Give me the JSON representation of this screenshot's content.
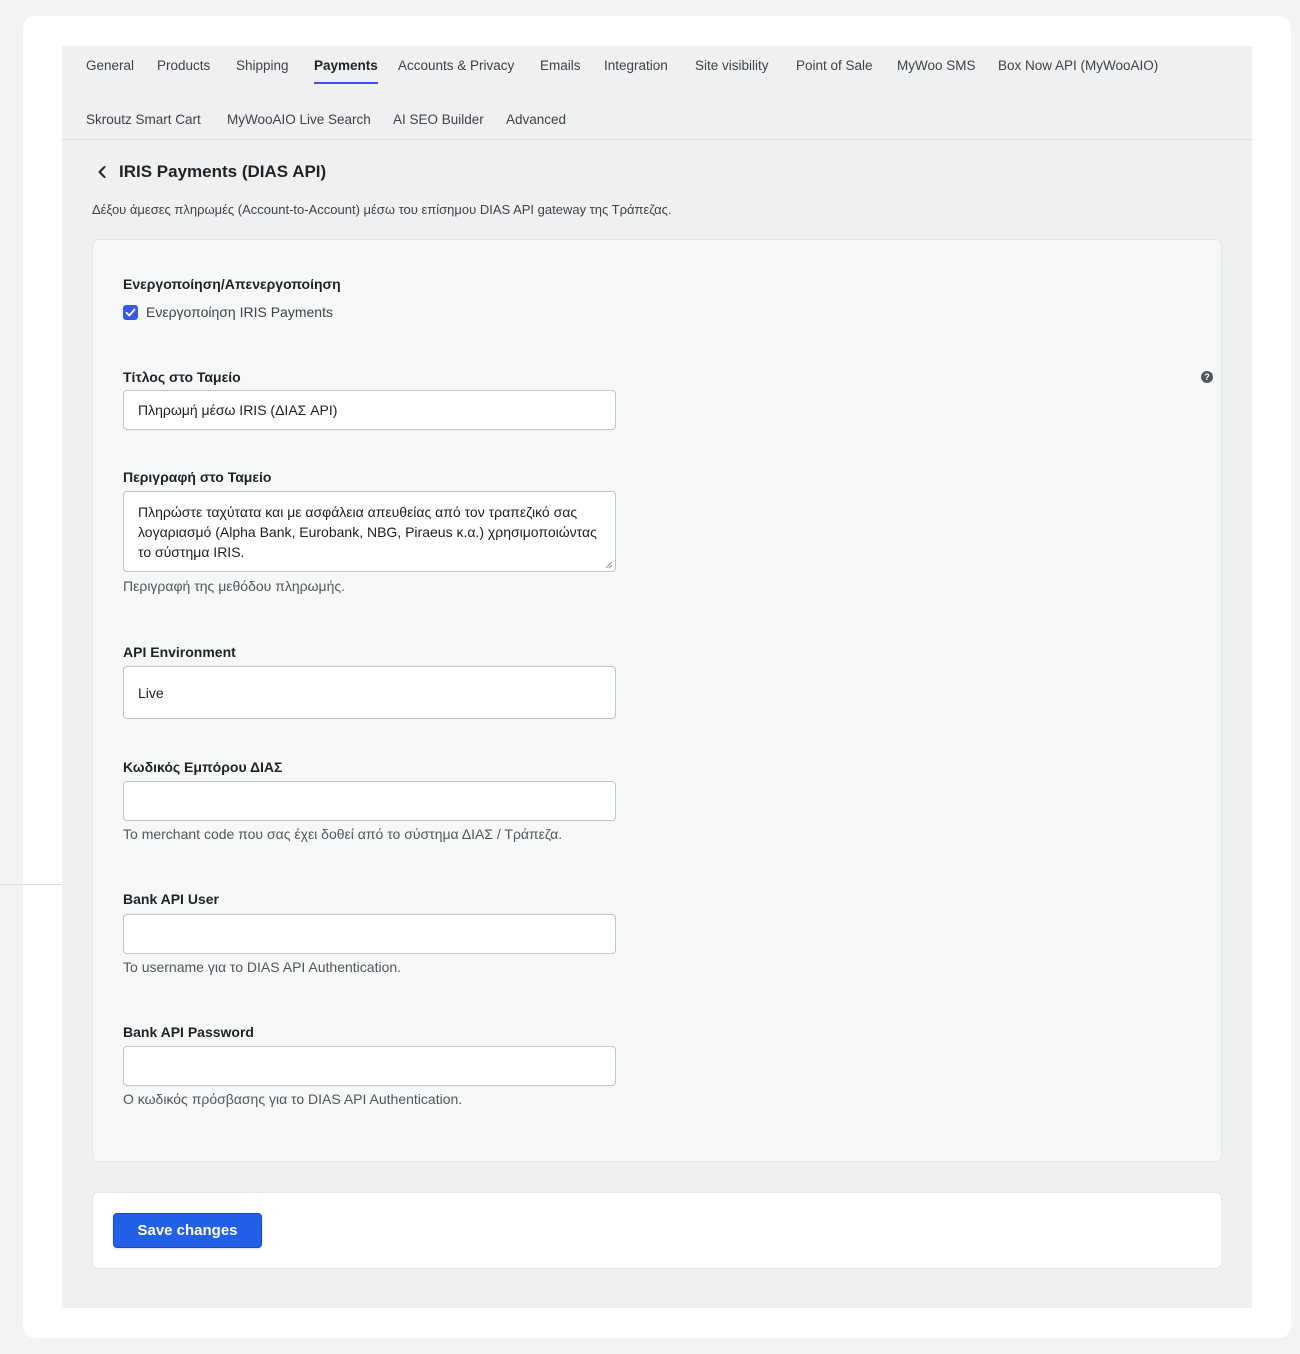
{
  "tabs": {
    "row1": [
      "General",
      "Products",
      "Shipping",
      "Payments",
      "Accounts & Privacy",
      "Emails",
      "Integration",
      "Site visibility",
      "Point of Sale",
      "MyWoo SMS",
      "Box Now API (MyWooAIO)"
    ],
    "row2": [
      "Skroutz Smart Cart",
      "MyWooAIO Live Search",
      "AI SEO Builder",
      "Advanced"
    ],
    "active": "Payments"
  },
  "page": {
    "title": "IRIS Payments (DIAS API)",
    "description": "Δέξου άμεσες πληρωμές (Account-to-Account) μέσω του επίσημου DIAS API gateway της Τράπεζας."
  },
  "form": {
    "enable": {
      "label": "Ενεργοποίηση/Απενεργοποίηση",
      "checkbox_label": "Ενεργοποίηση IRIS Payments",
      "checked": true
    },
    "title": {
      "label": "Τίτλος στο Ταμείο",
      "value": "Πληρωμή μέσω IRIS (ΔΙΑΣ API)",
      "help_icon": "question-circle-icon"
    },
    "description": {
      "label": "Περιγραφή στο Ταμείο",
      "value": "Πληρώστε ταχύτατα και με ασφάλεια απευθείας από τον τραπεζικό σας λογαριασμό (Alpha Bank, Eurobank, NBG, Piraeus κ.α.) χρησιμοποιώντας το σύστημα IRIS.",
      "help": "Περιγραφή της μεθόδου πληρωμής."
    },
    "api_environment": {
      "label": "API Environment",
      "value": "Live"
    },
    "merchant_code": {
      "label": "Κωδικός Εμπόρου ΔΙΑΣ",
      "value": "",
      "help": "Το merchant code που σας έχει δοθεί από το σύστημα ΔΙΑΣ / Τράπεζα."
    },
    "api_user": {
      "label": "Bank API User",
      "value": "",
      "help": "Το username για το DIAS API Authentication."
    },
    "api_password": {
      "label": "Bank API Password",
      "value": "",
      "help": "Ο κωδικός πρόσβασης για το DIAS API Authentication."
    }
  },
  "actions": {
    "save_label": "Save changes"
  },
  "colors": {
    "accent": "#3858e9",
    "button": "#2260e8"
  }
}
